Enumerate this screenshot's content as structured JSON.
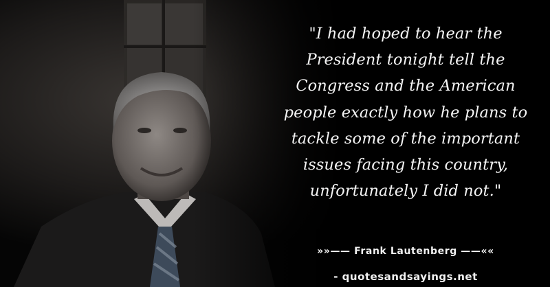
{
  "quote": {
    "lines": [
      "\"I had hoped to hear the",
      "President tonight tell the",
      "Congress and the American",
      "people exactly how he plans to",
      "tackle some of the important",
      "issues facing this country,",
      "unfortunately I did not.\""
    ]
  },
  "attribution": "»»—— Frank Lautenberg ——««",
  "source": "- quotesandsayings.net",
  "colors": {
    "background": "#000000",
    "text": "#f4f4f4"
  }
}
